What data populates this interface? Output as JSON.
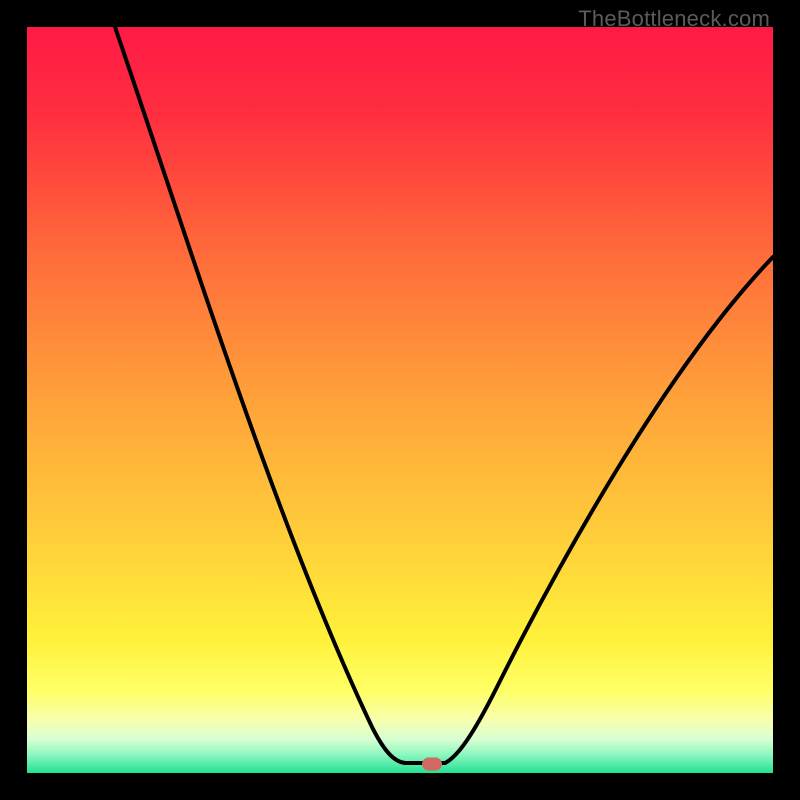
{
  "watermark": "TheBottleneck.com",
  "chart_data": {
    "type": "line",
    "title": "",
    "xlabel": "",
    "ylabel": "",
    "xlim": [
      0,
      100
    ],
    "ylim": [
      0,
      100
    ],
    "grid": false,
    "legend": false,
    "background_gradient": {
      "direction": "vertical",
      "stops": [
        {
          "pct": 0,
          "color": "#ff1a46"
        },
        {
          "pct": 12,
          "color": "#ff2f3f"
        },
        {
          "pct": 30,
          "color": "#ff6a3a"
        },
        {
          "pct": 50,
          "color": "#ffa23a"
        },
        {
          "pct": 70,
          "color": "#ffd23a"
        },
        {
          "pct": 82,
          "color": "#fff13a"
        },
        {
          "pct": 89,
          "color": "#ffff66"
        },
        {
          "pct": 93,
          "color": "#f6ffb0"
        },
        {
          "pct": 95.5,
          "color": "#d7ffd2"
        },
        {
          "pct": 97.5,
          "color": "#8ef7c0"
        },
        {
          "pct": 100,
          "color": "#22e193"
        }
      ]
    },
    "series": [
      {
        "name": "bottleneck-curve",
        "color": "#000000",
        "x": [
          12,
          18,
          25,
          32,
          38,
          44,
          48,
          51,
          54,
          56,
          60,
          66,
          74,
          84,
          94,
          100
        ],
        "values": [
          100,
          82,
          65,
          48,
          33,
          18,
          8,
          2,
          1,
          1,
          5,
          15,
          32,
          52,
          65,
          69
        ]
      }
    ],
    "annotations": [
      {
        "name": "optimal-point",
        "shape": "rounded-rect",
        "x": 54.3,
        "y": 1.2,
        "color": "#cf6a61"
      }
    ]
  }
}
